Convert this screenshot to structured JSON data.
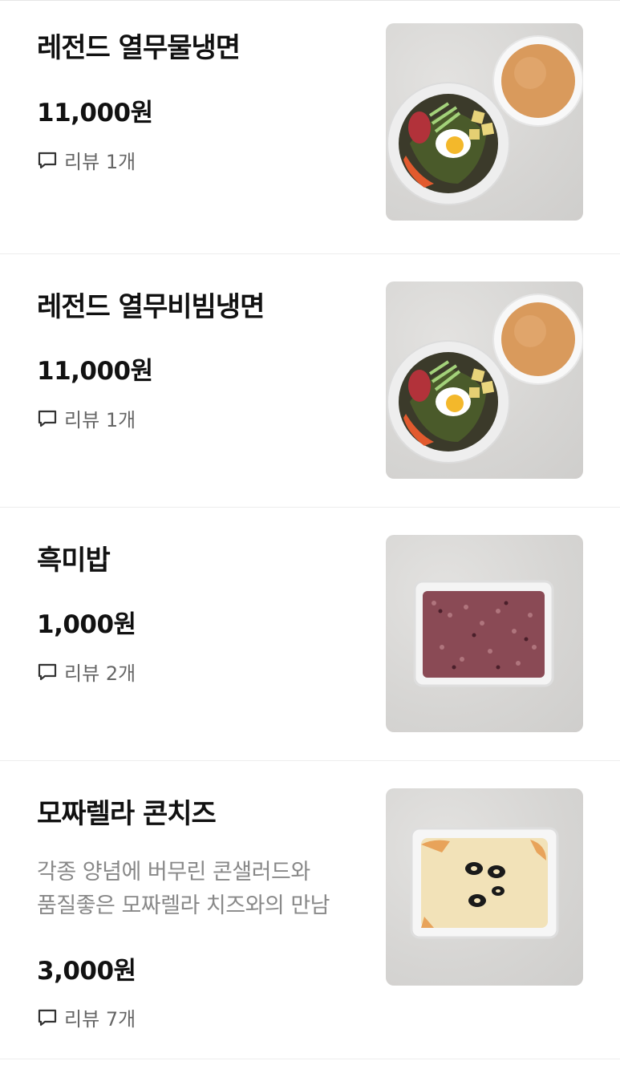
{
  "items": [
    {
      "name": "레전드 열무물냉면",
      "price": "11,000원",
      "review_label": "리뷰",
      "review_count": "1개",
      "image": "bowl-noodles-with-broth"
    },
    {
      "name": "레전드 열무비빔냉면",
      "price": "11,000원",
      "review_label": "리뷰",
      "review_count": "1개",
      "image": "bowl-noodles-with-broth"
    },
    {
      "name": "흑미밥",
      "price": "1,000원",
      "review_label": "리뷰",
      "review_count": "2개",
      "image": "black-rice-container"
    },
    {
      "name": "모짜렐라 콘치즈",
      "description": [
        "각종 양념에 버무린 콘샐러드와",
        "품질좋은 모짜렐라 치즈와의 만남"
      ],
      "price": "3,000원",
      "review_label": "리뷰",
      "review_count": "7개",
      "image": "corn-cheese-container"
    }
  ]
}
